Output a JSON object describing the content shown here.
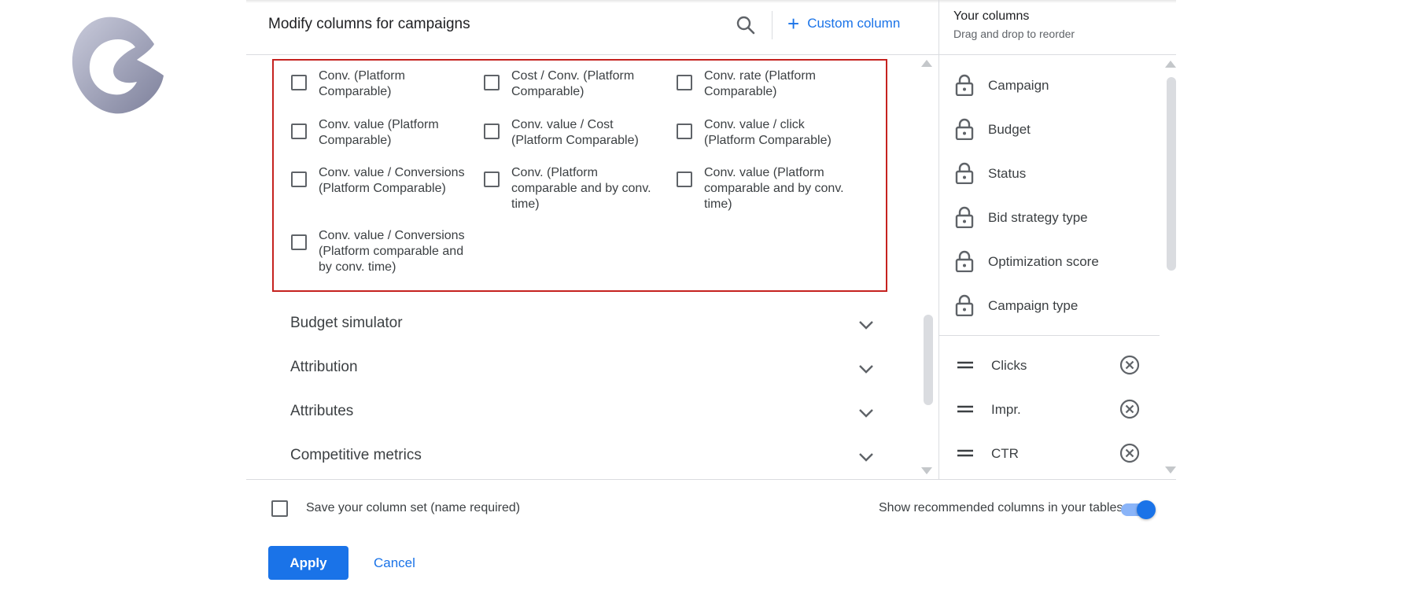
{
  "dialog": {
    "title": "Modify columns for campaigns",
    "custom_column_label": "Custom column"
  },
  "options": [
    "Conv. (Platform\nComparable)",
    "Cost / Conv. (Platform\nComparable)",
    "Conv. rate (Platform\nComparable)",
    "Conv. value (Platform\nComparable)",
    "Conv. value / Cost\n(Platform Comparable)",
    "Conv. value / click\n(Platform Comparable)",
    "Conv. value / Conversions\n(Platform Comparable)",
    "Conv. (Platform\ncomparable and by conv.\ntime)",
    "Conv. value (Platform\ncomparable and by conv.\ntime)",
    "Conv. value / Conversions\n(Platform comparable and\nby conv. time)"
  ],
  "sections": [
    "Budget simulator",
    "Attribution",
    "Attributes",
    "Competitive metrics"
  ],
  "your_columns": {
    "title": "Your columns",
    "subtitle": "Drag and drop to reorder",
    "locked": [
      "Campaign",
      "Budget",
      "Status",
      "Bid strategy type",
      "Optimization score",
      "Campaign type"
    ],
    "movable": [
      "Clicks",
      "Impr.",
      "CTR"
    ]
  },
  "footer": {
    "save_label": "Save your column set (name required)",
    "recommended_label": "Show recommended columns in your tables",
    "recommended_on": true,
    "apply_label": "Apply",
    "cancel_label": "Cancel"
  },
  "colors": {
    "accent": "#1a73e8",
    "highlight_border": "#c5221f"
  }
}
